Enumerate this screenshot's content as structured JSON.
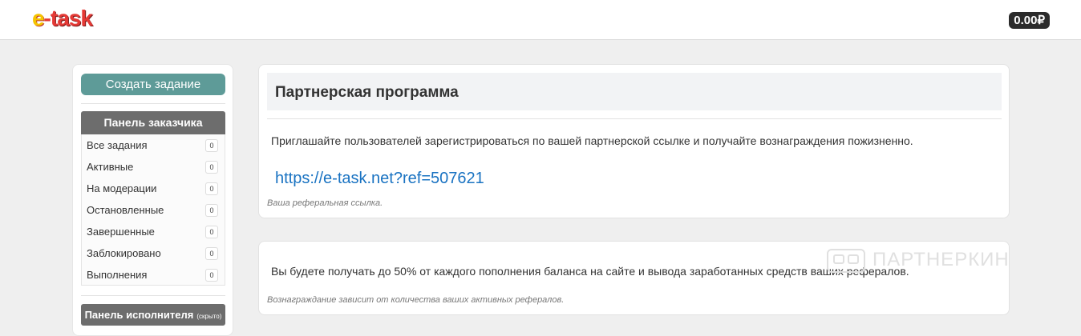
{
  "header": {
    "logo_text": "e-task",
    "balance": "0.00₽"
  },
  "sidebar": {
    "create_button": "Создать задание",
    "customer_panel": {
      "title": "Панель заказчика",
      "items": [
        {
          "label": "Все задания",
          "count": "0"
        },
        {
          "label": "Активные",
          "count": "0"
        },
        {
          "label": "На модерации",
          "count": "0"
        },
        {
          "label": "Остановленные",
          "count": "0"
        },
        {
          "label": "Завершенные",
          "count": "0"
        },
        {
          "label": "Заблокировано",
          "count": "0"
        },
        {
          "label": "Выполнения",
          "count": "0"
        }
      ]
    },
    "executor_panel": {
      "title": "Панель исполнителя",
      "note": "(скрыто)"
    }
  },
  "main": {
    "partner_card": {
      "title": "Партнерская программа",
      "description": "Приглашайте пользователей зарегистрироваться по вашей партнерской ссылке и получайте вознаграждения пожизненно.",
      "ref_link": "https://e-task.net?ref=507621",
      "ref_note": "Ваша реферальная ссылка."
    },
    "reward_card": {
      "description": "Вы будете получать до 50% от каждого пополнения баланса на сайте и вывода заработанных средств ваших рефералов.",
      "note": "Вознаграждание зависит от количества ваших активных рефералов."
    }
  },
  "watermark": "ПАРТНЕРКИН",
  "colors": {
    "accent_button": "#5e9b98",
    "panel_header": "#6d6d6d",
    "link": "#1a73c2",
    "balance_bg": "#2b2b2b"
  }
}
